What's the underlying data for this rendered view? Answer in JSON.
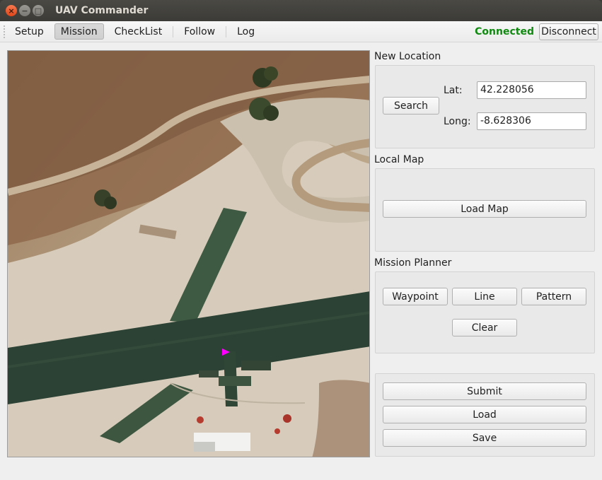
{
  "window": {
    "title": "UAV Commander"
  },
  "tabs": [
    {
      "label": "Setup"
    },
    {
      "label": "Mission"
    },
    {
      "label": "CheckList"
    },
    {
      "label": "Follow"
    },
    {
      "label": "Log"
    }
  ],
  "active_tab": "Mission",
  "connection": {
    "status": "Connected",
    "status_color": "#108a10",
    "disconnect_label": "Disconnect"
  },
  "new_location": {
    "title": "New Location",
    "search_label": "Search",
    "lat_label": "Lat:",
    "lat_value": "42.228056",
    "long_label": "Long:",
    "long_value": "-8.628306"
  },
  "local_map": {
    "title": "Local Map",
    "load_map_label": "Load Map"
  },
  "mission_planner": {
    "title": "Mission Planner",
    "waypoint_label": "Waypoint",
    "line_label": "Line",
    "pattern_label": "Pattern",
    "clear_label": "Clear"
  },
  "actions": {
    "submit_label": "Submit",
    "load_label": "Load",
    "save_label": "Save"
  },
  "map": {
    "marker_icon": "uav-marker-icon",
    "marker_color": "#ff00ff"
  }
}
